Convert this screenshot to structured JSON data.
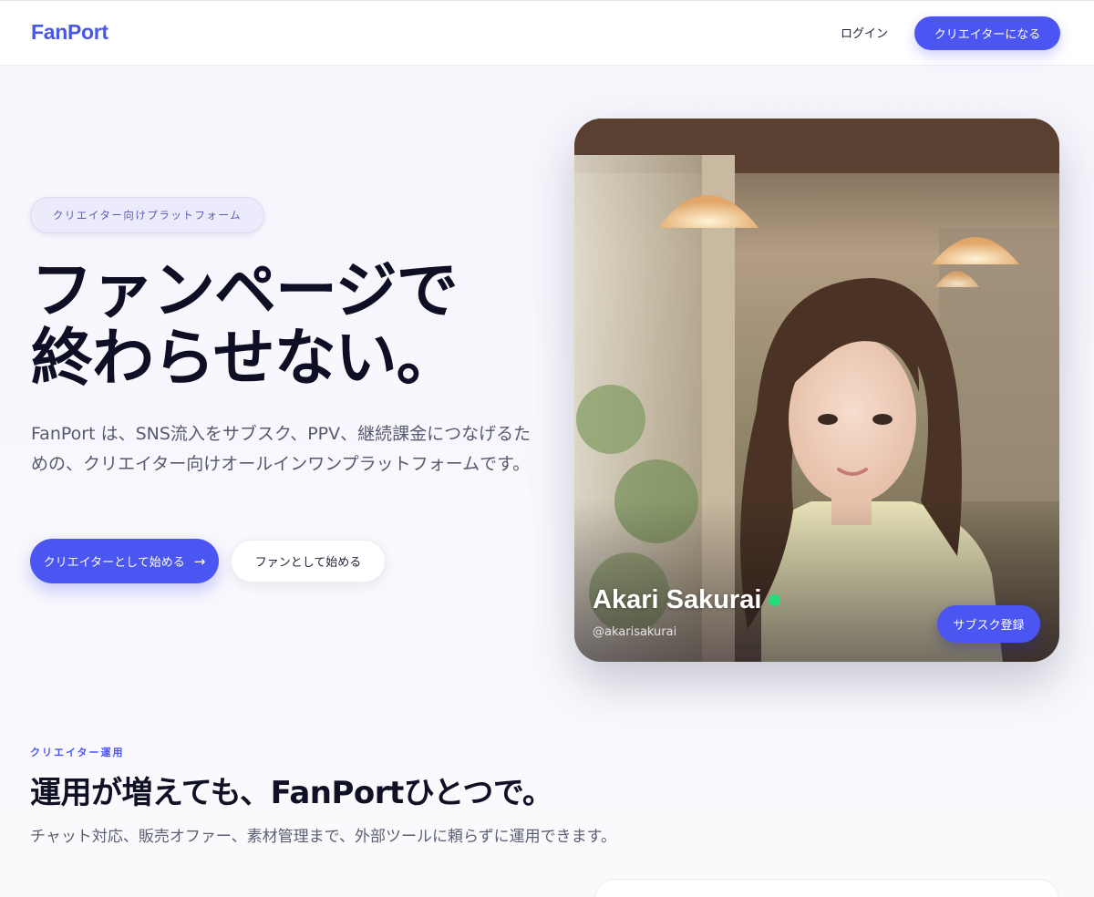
{
  "header": {
    "logo": "FanPort",
    "login_label": "ログイン",
    "cta_label": "クリエイターになる"
  },
  "hero": {
    "badge": "クリエイター向けプラットフォーム",
    "title_line1": "ファンページで",
    "title_line2": "終わらせない。",
    "description": "FanPort は、SNS流入をサブスク、PPV、継続課金につなげるための、クリエイター向けオールインワンプラットフォームです。",
    "primary_button": "クリエイターとして始める",
    "primary_button_icon": "arrow-right-icon",
    "secondary_button": "ファンとして始める"
  },
  "creator_card": {
    "name": "Akari Sakurai",
    "handle": "@akarisakurai",
    "status": "online",
    "subscribe_label": "サブスク登録"
  },
  "section": {
    "eyebrow": "クリエイター運用",
    "title": "運用が増えても、FanPortひとつで。",
    "description": "チャット対応、販売オファー、素材管理まで、外部ツールに頼らずに運用できます。"
  },
  "colors": {
    "accent": "#4b55f2",
    "online": "#22dd7a",
    "heading": "#0e0e24",
    "body_text": "#555a6e"
  }
}
